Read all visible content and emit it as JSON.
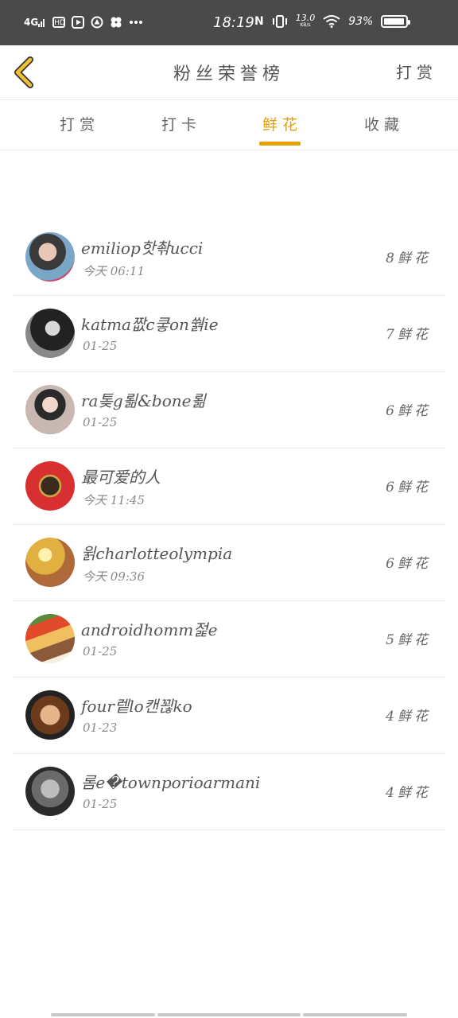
{
  "status_bar": {
    "network": "4G",
    "hd": "HD",
    "time": "18:19",
    "nfc": "N",
    "speed_value": "13.0",
    "speed_unit": "KB/s",
    "battery": "93",
    "battery_level": 0.93
  },
  "header": {
    "title": "粉丝荣誉榜",
    "reward_link": "打赏"
  },
  "tabs": [
    {
      "label": "打赏",
      "active": false
    },
    {
      "label": "打卡",
      "active": false
    },
    {
      "label": "鲜花",
      "active": true
    },
    {
      "label": "收藏",
      "active": false
    }
  ],
  "fans": [
    {
      "name": "emiliop핫촦ucci",
      "date": "今天 06:11",
      "count": "8鲜花"
    },
    {
      "name": "katma짮c쿻on쒉ie",
      "date": "01-25",
      "count": "7鲜花"
    },
    {
      "name": "ra톶g뢺&bone뢺",
      "date": "01-25",
      "count": "6鲜花"
    },
    {
      "name": "最可爱的人",
      "date": "今天 11:45",
      "count": "6鲜花"
    },
    {
      "name": "윍charlotteolympia",
      "date": "今天 09:36",
      "count": "6鲜花"
    },
    {
      "name": "androidhomm젍e",
      "date": "01-25",
      "count": "5鲜花"
    },
    {
      "name": "four렡lo캔꾆ko",
      "date": "01-23",
      "count": "4鲜花"
    },
    {
      "name": "롬e�townporioarmani",
      "date": "01-25",
      "count": "4鲜花"
    }
  ],
  "colors": {
    "accent": "#e6a000",
    "status_bar": "#4a4a4a"
  }
}
